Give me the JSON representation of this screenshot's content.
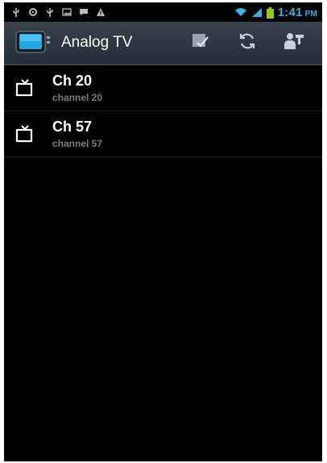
{
  "status_bar": {
    "time": "1:41",
    "ampm": "PM",
    "left_icons": [
      "usb-icon",
      "gear-icon",
      "usb-icon",
      "image-icon",
      "message-icon",
      "warning-icon"
    ],
    "right_icons": [
      "wifi-icon",
      "signal-icon",
      "battery-icon"
    ],
    "accent_color": "#33b5e5"
  },
  "action_bar": {
    "title": "Analog TV",
    "actions": [
      "edit-check-icon",
      "refresh-icon",
      "settings-person-icon"
    ]
  },
  "channels": [
    {
      "name": "Ch 20",
      "subtitle": "channel 20"
    },
    {
      "name": "Ch 57",
      "subtitle": "channel 57"
    }
  ]
}
